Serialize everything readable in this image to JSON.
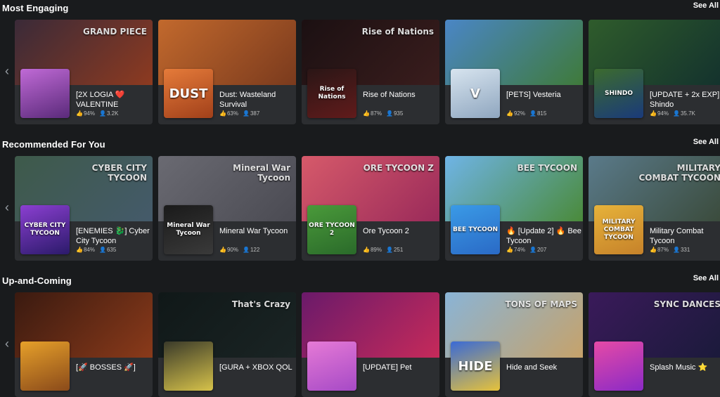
{
  "sections": [
    {
      "title": "Most Engaging",
      "see_all": "See All",
      "cards": [
        {
          "name": "[2X LOGIA ❤️ VALENTINE",
          "rating": "94%",
          "players": "3.2K",
          "icon_text": "",
          "thumb_text": "GRAND PIECE",
          "thumb_colors": [
            "#3a2a38",
            "#8d3a20"
          ],
          "icon_colors": [
            "#c06ad6",
            "#5a2a7a"
          ]
        },
        {
          "name": "Dust: Wasteland Survival",
          "rating": "63%",
          "players": "387",
          "icon_text": "DUST",
          "thumb_text": "",
          "thumb_colors": [
            "#c2692d",
            "#7a3a1d"
          ],
          "icon_colors": [
            "#e57b3a",
            "#a1401a"
          ]
        },
        {
          "name": "Rise of Nations",
          "rating": "87%",
          "players": "935",
          "icon_text": "Rise of Nations",
          "thumb_text": "Rise of Nations",
          "thumb_colors": [
            "#1b1012",
            "#3a1d1d"
          ],
          "icon_colors": [
            "#2a1616",
            "#611b1b"
          ]
        },
        {
          "name": "[PETS] Vesteria",
          "rating": "92%",
          "players": "815",
          "icon_text": "V",
          "thumb_text": "",
          "thumb_colors": [
            "#4a86c6",
            "#3f7a3a"
          ],
          "icon_colors": [
            "#d7e4ef",
            "#8fa6bf"
          ]
        },
        {
          "name": "[UPDATE + 2x EXP] Shindo",
          "rating": "94%",
          "players": "35.7K",
          "icon_text": "SHINDO",
          "thumb_text": "",
          "thumb_colors": [
            "#2f5c2c",
            "#13312d"
          ],
          "icon_colors": [
            "#3c6b2e",
            "#1a3a7a"
          ]
        }
      ]
    },
    {
      "title": "Recommended For You",
      "see_all": "See All",
      "cards": [
        {
          "name": "[ENEMIES 🐉] Cyber City Tycoon",
          "rating": "84%",
          "players": "635",
          "icon_text": "CYBER CITY TYCOON",
          "thumb_text": "CYBER CITY TYCOON",
          "thumb_colors": [
            "#3e5a4a",
            "#445a6a"
          ],
          "icon_colors": [
            "#8b3fd1",
            "#2b1a6a"
          ]
        },
        {
          "name": "Mineral War Tycoon",
          "rating": "90%",
          "players": "122",
          "icon_text": "Mineral War Tycoon",
          "thumb_text": "Mineral War Tycoon",
          "thumb_colors": [
            "#6a6a72",
            "#4a4a52"
          ],
          "icon_colors": [
            "#1a1a1a",
            "#3a3a3a"
          ]
        },
        {
          "name": "Ore Tycoon 2",
          "rating": "89%",
          "players": "251",
          "icon_text": "ORE TYCOON 2",
          "thumb_text": "ORE TYCOON Z",
          "thumb_colors": [
            "#d65a6a",
            "#9a2a5a"
          ],
          "icon_colors": [
            "#4a9a3a",
            "#2a6a2a"
          ]
        },
        {
          "name": "🔥 [Update 2] 🔥 Bee Tycoon",
          "rating": "74%",
          "players": "207",
          "icon_text": "BEE TYCOON",
          "thumb_text": "BEE TYCOON",
          "thumb_colors": [
            "#6fb4e6",
            "#4a8a3a"
          ],
          "icon_colors": [
            "#3a9ae6",
            "#2a6ac6"
          ]
        },
        {
          "name": "Military Combat Tycoon",
          "rating": "87%",
          "players": "331",
          "icon_text": "MILITARY COMBAT TYCOON",
          "thumb_text": "MILITARY COMBAT TYCOON",
          "thumb_colors": [
            "#5a7a8a",
            "#3a4a3a"
          ],
          "icon_colors": [
            "#e6b23a",
            "#c6822a"
          ]
        }
      ]
    },
    {
      "title": "Up-and-Coming",
      "see_all": "See All",
      "cards": [
        {
          "name": "[🚀 BOSSES 🚀]",
          "rating": "",
          "players": "",
          "icon_text": "",
          "thumb_text": "",
          "thumb_colors": [
            "#3a1a10",
            "#8a3a1a"
          ],
          "icon_colors": [
            "#e6a02a",
            "#8a4a1a"
          ]
        },
        {
          "name": "[GURA + XBOX QOL",
          "rating": "",
          "players": "",
          "icon_text": "",
          "thumb_text": "That's Crazy",
          "thumb_colors": [
            "#101818",
            "#1a2424"
          ],
          "icon_colors": [
            "#3a3a2a",
            "#d6c24a"
          ]
        },
        {
          "name": "[UPDATE] Pet",
          "rating": "",
          "players": "",
          "icon_text": "",
          "thumb_text": "",
          "thumb_colors": [
            "#6a1a6a",
            "#c62a5a"
          ],
          "icon_colors": [
            "#e67ad6",
            "#a64ac6"
          ]
        },
        {
          "name": "Hide and Seek",
          "rating": "",
          "players": "",
          "icon_text": "HIDE",
          "thumb_text": "TONS OF MAPS",
          "thumb_colors": [
            "#8ab4d6",
            "#c6a26a"
          ],
          "icon_colors": [
            "#3a6ad6",
            "#e6c23a"
          ]
        },
        {
          "name": "Splash Music ⭐",
          "rating": "",
          "players": "",
          "icon_text": "",
          "thumb_text": "SYNC DANCES",
          "thumb_colors": [
            "#3a1a5a",
            "#1a1a3a"
          ],
          "icon_colors": [
            "#e64aa6",
            "#8a2ac6"
          ]
        }
      ]
    }
  ],
  "icons": {
    "thumbs_up": "thumbs-up-icon",
    "players": "players-icon",
    "scroll_left": "chevron-left-icon"
  },
  "colors": {
    "background": "#191b1d",
    "card": "#2c2e31",
    "stat_text": "#bdbebe"
  }
}
